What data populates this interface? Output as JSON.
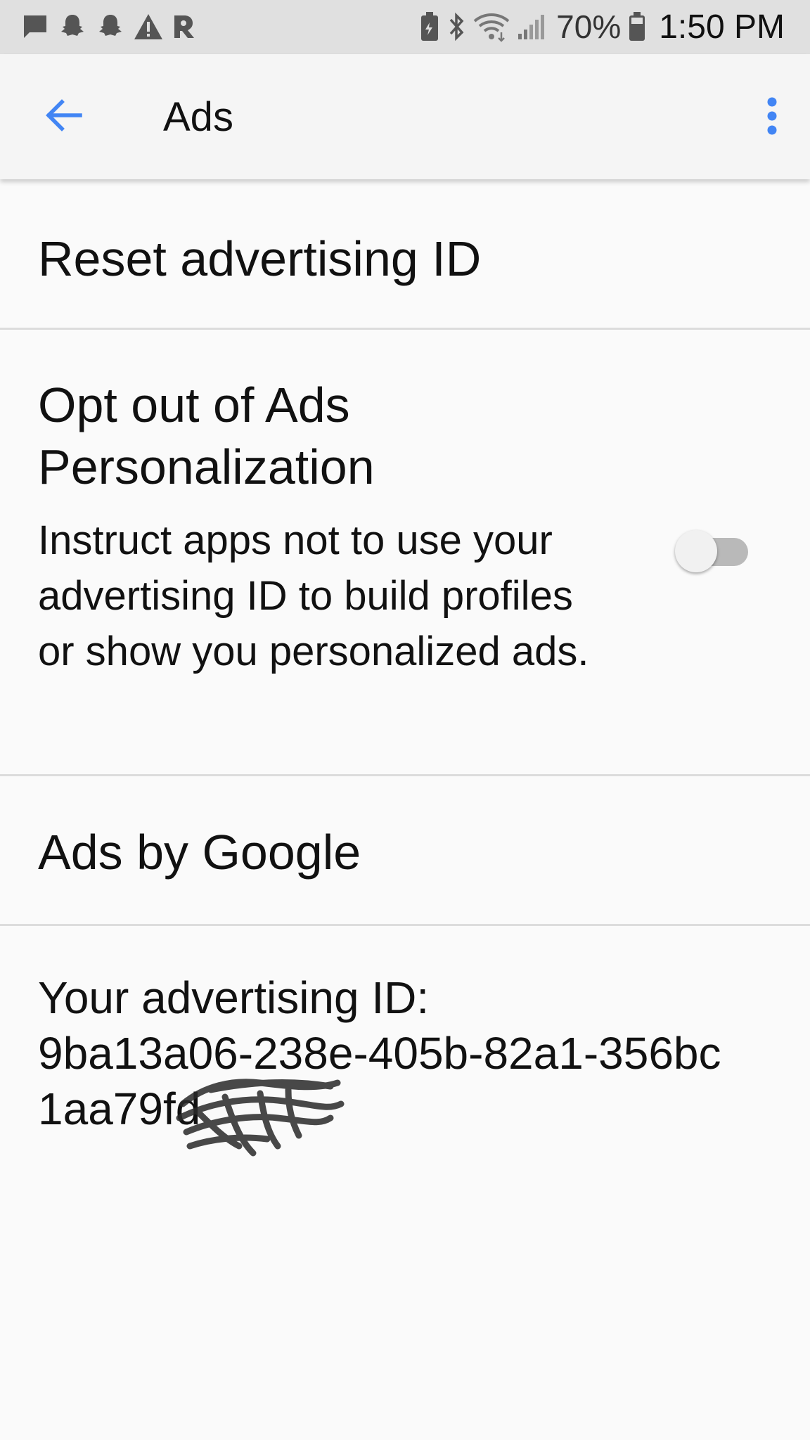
{
  "status_bar": {
    "battery_percent": "70%",
    "time": "1:50 PM",
    "left_icons": [
      "message-icon",
      "snapchat-icon",
      "snapchat-icon",
      "warning-icon",
      "app-icon"
    ],
    "right_icons": [
      "battery-saver-icon",
      "bluetooth-icon",
      "wifi-icon",
      "signal-icon",
      "battery-icon"
    ]
  },
  "app_bar": {
    "title": "Ads",
    "back_icon": "arrow-back-icon",
    "overflow_icon": "more-vert-icon",
    "accent_color": "#4285f4"
  },
  "preferences": {
    "reset_title": "Reset advertising ID",
    "opt_out_title": "Opt out of Ads Personalization",
    "opt_out_summary": "Instruct apps not to use your advertising ID to build profiles or show you personalized ads.",
    "opt_out_enabled": false,
    "ads_by_google_title": "Ads by Google",
    "advertising_id_label": "Your advertising ID:",
    "advertising_id_value": "9ba13a06-238e-405b-82a1-356bc1aa79fd"
  }
}
